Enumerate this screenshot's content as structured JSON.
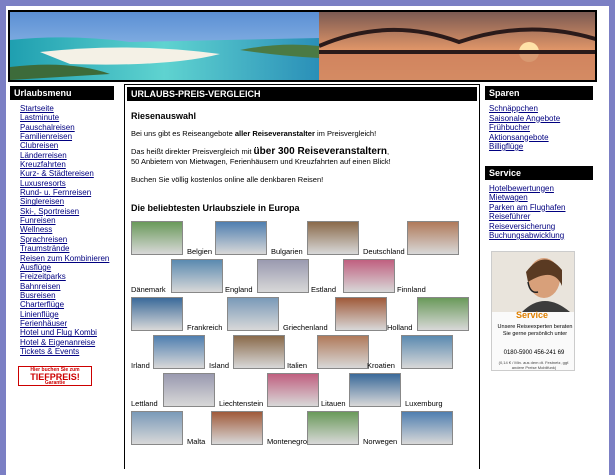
{
  "menu": {
    "title": "Urlaubsmenu",
    "items": [
      "Startseite",
      "Lastminute",
      "Pauschalreisen",
      "Familienreisen",
      "Clubreisen",
      "Länderreisen",
      "Kreuzfahrten",
      "Kurz- & Städtereisen",
      "Luxusresorts",
      "Rund- u. Fernreisen",
      "Singlereisen",
      "Ski-, Sportreisen",
      "Funreisen",
      "Wellness",
      "Sprachreisen",
      "Traumstrände",
      "Reisen zum Kombinieren",
      "Ausflüge",
      "Freizeitparks",
      "Bahnreisen",
      "Busreisen",
      "Charterflüge",
      "Linienflüge",
      "Ferienhäuser",
      "Hotel und Flug Kombi",
      "Hotel & Eigenanreise",
      "Tickets & Events"
    ],
    "badge_top": "Hier buchen Sie zum",
    "badge_big": "TIEFPREIS!",
    "badge_small": "Garantie"
  },
  "main": {
    "head": "URLAUBS-PREIS-VERGLEICH",
    "subhead": "Riesenauswahl",
    "p1_a": "Bei uns gibt es Reiseangebote ",
    "p1_b": "aller Reiseveranstalter",
    "p1_c": " im Preisvergleich!",
    "p2_a": "Das heißt direkter Preisvergleich mit ",
    "p2_b": "über 300 Reiseveranstaltern",
    "p2_c": ",",
    "p2_d": "50 Anbietern von Mietwagen, Ferienhäusern und Kreuzfahrten auf einen Blick!",
    "p3": "Buchen Sie völlig kostenlos online alle denkbaren Reisen!",
    "destinations_title": "Die beliebtesten Urlaubsziele in Europa",
    "destinations": [
      "Belgien",
      "Bulgarien",
      "Deutschland",
      "Dänemark",
      "England",
      "Estland",
      "Finnland",
      "Frankreich",
      "Griechenland",
      "Holland",
      "Irland",
      "Island",
      "Italien",
      "Kroatien",
      "Lettland",
      "Liechtenstein",
      "Litauen",
      "Luxemburg",
      "Malta",
      "Montenegro",
      "Norwegen"
    ]
  },
  "sparen": {
    "title": "Sparen",
    "items": [
      "Schnäppchen",
      "Saisonale Angebote",
      "Frühbucher",
      "Aktionsangebote",
      "Billigflüge"
    ]
  },
  "service": {
    "title": "Service",
    "items": [
      "Hotelbewertungen",
      "Mietwagen",
      "Parken am Flughafen",
      "Reiseführer",
      "Reiseversicherung",
      "Buchungsabwicklung"
    ],
    "ad_title": "Service",
    "ad_text": "Unsere Reiseexperten beraten Sie gerne persönlich unter",
    "ad_phone": "0180-5900 456-241 69",
    "ad_small": "(0,14 € / Min. aus dem dt. Festnetz, ggf. andere Preise Mobilfunk)"
  }
}
